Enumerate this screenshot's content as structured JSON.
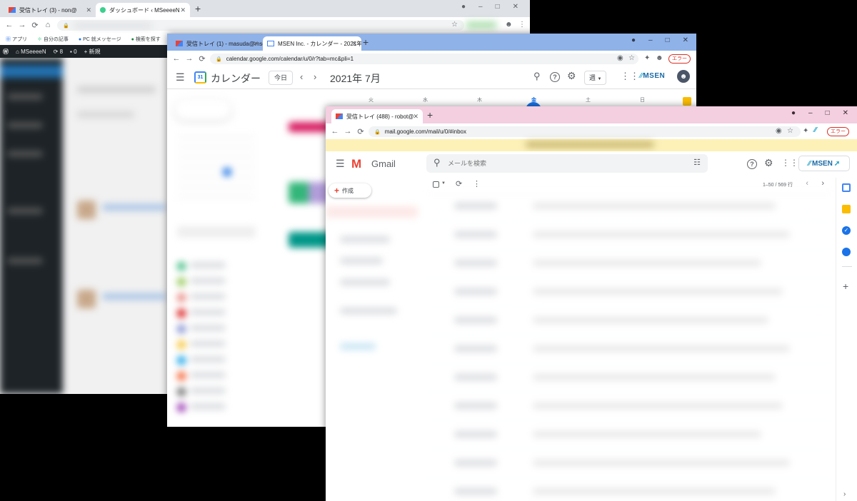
{
  "wp_window": {
    "tabs": [
      {
        "label": "受信トレイ (3) - non@",
        "icon": "gmail-icon"
      },
      {
        "label": "ダッシュボード ‹ MSeeeeN",
        "icon": "wordpress-icon"
      }
    ],
    "bookmarks": [
      "アプリ",
      "自分の記事",
      "PC 就メッセージ",
      "検索を探す"
    ],
    "admin_bar": {
      "site": "MSeeeeN",
      "comments": "8",
      "updates": "0",
      "new": "新規"
    }
  },
  "calendar_window": {
    "tabs": [
      {
        "label": "受信トレイ (1) - masuda@msen.jp",
        "icon": "gmail-icon"
      },
      {
        "label": "MSEN Inc. - カレンダー - 2021年 7月",
        "icon": "calendar-icon"
      }
    ],
    "url": "calendar.google.com/calendar/u/0/r?tab=mc&pli=1",
    "app_name": "カレンダー",
    "today_button": "今日",
    "month_label": "2021年 7月",
    "view_select": "週",
    "brand": "MSEN",
    "error_badge": "エラー",
    "weekdays": [
      "火",
      "水",
      "木",
      "金",
      "土",
      "日"
    ],
    "calendar_badge": "31"
  },
  "gmail_window": {
    "tabs": [
      {
        "label": "受信トレイ (488) - robot@",
        "icon": "gmail-icon"
      }
    ],
    "url": "mail.google.com/mail/u/0/#inbox",
    "app_name": "Gmail",
    "search_placeholder": "メールを検索",
    "compose": "作成",
    "pagination": "1–50 / 569 行",
    "brand": "MSEN",
    "error_badge": "エラー"
  },
  "colors": {
    "wp_admin": "#1d2327",
    "calendar_tabstrip": "#8fb2e8",
    "gmail_tabstrip": "#f3cfe0",
    "gmail_banner": "#fdf1b8",
    "google_blue": "#1a73e8",
    "gmail_red": "#ea4335"
  }
}
